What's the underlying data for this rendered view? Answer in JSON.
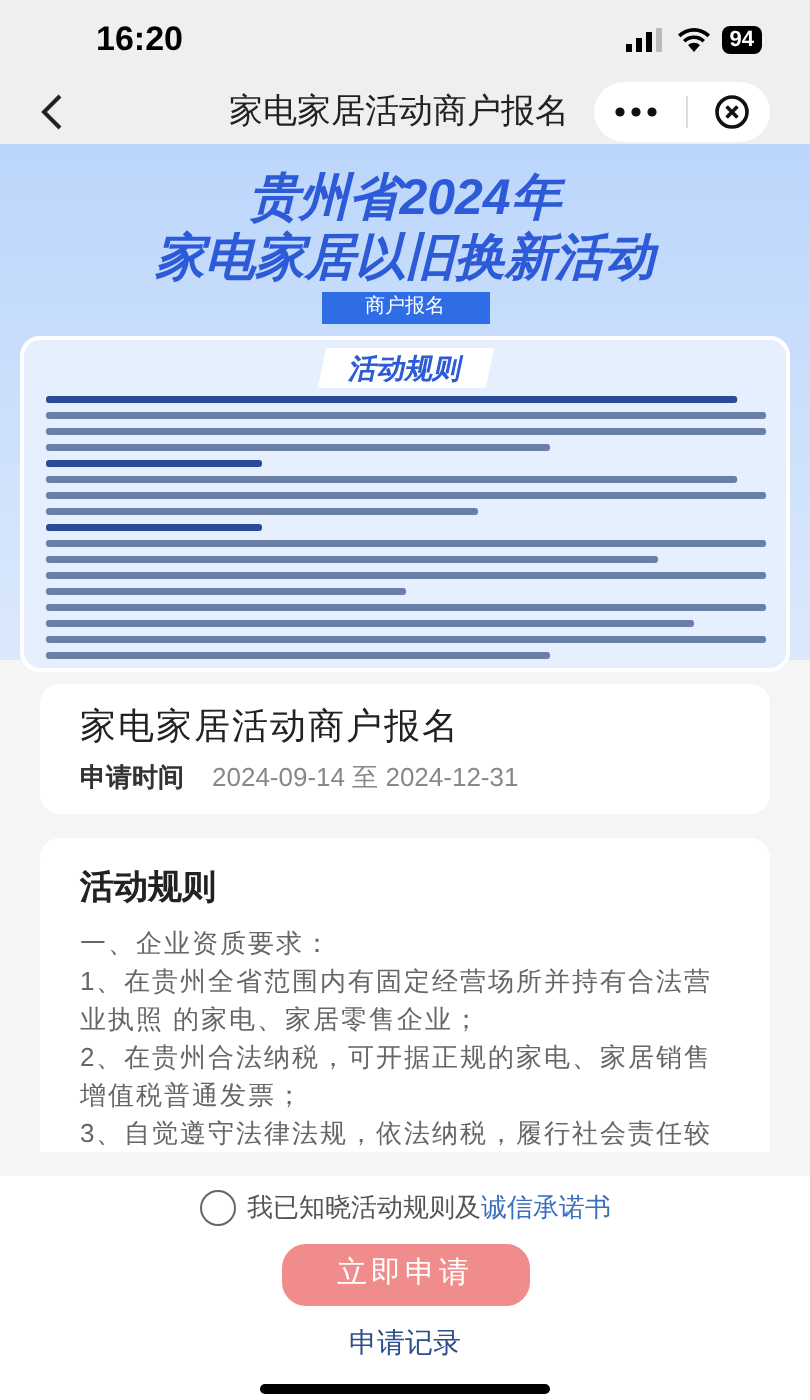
{
  "status_bar": {
    "time": "16:20",
    "battery": "94"
  },
  "nav": {
    "title": "家电家居活动商户报名"
  },
  "banner": {
    "headline_1": "贵州省2024年",
    "headline_2": "家电家居以旧换新活动",
    "tag": "商户报名",
    "panel_title": "活动规则"
  },
  "info_card": {
    "title": "家电家居活动商户报名",
    "time_label": "申请时间",
    "time_value": "2024-09-14 至 2024-12-31"
  },
  "rules_card": {
    "title": "活动规则",
    "paragraphs": [
      "一、企业资质要求：",
      "1、在贵州全省范围内有固定经营场所并持有合法营业执照 的家电、家居零售企业；",
      "2、在贵州合法纳税，可开据正规的家电、家居销售增值税普通发票；",
      "3、自觉遵守法律法规，依法纳税，履行社会责任较"
    ]
  },
  "agreement": {
    "checked": false,
    "text": "我已知晓活动规则及",
    "link": "诚信承诺书"
  },
  "apply_button": {
    "label": "立即申请",
    "disabled": true
  },
  "records_link": "申请记录"
}
